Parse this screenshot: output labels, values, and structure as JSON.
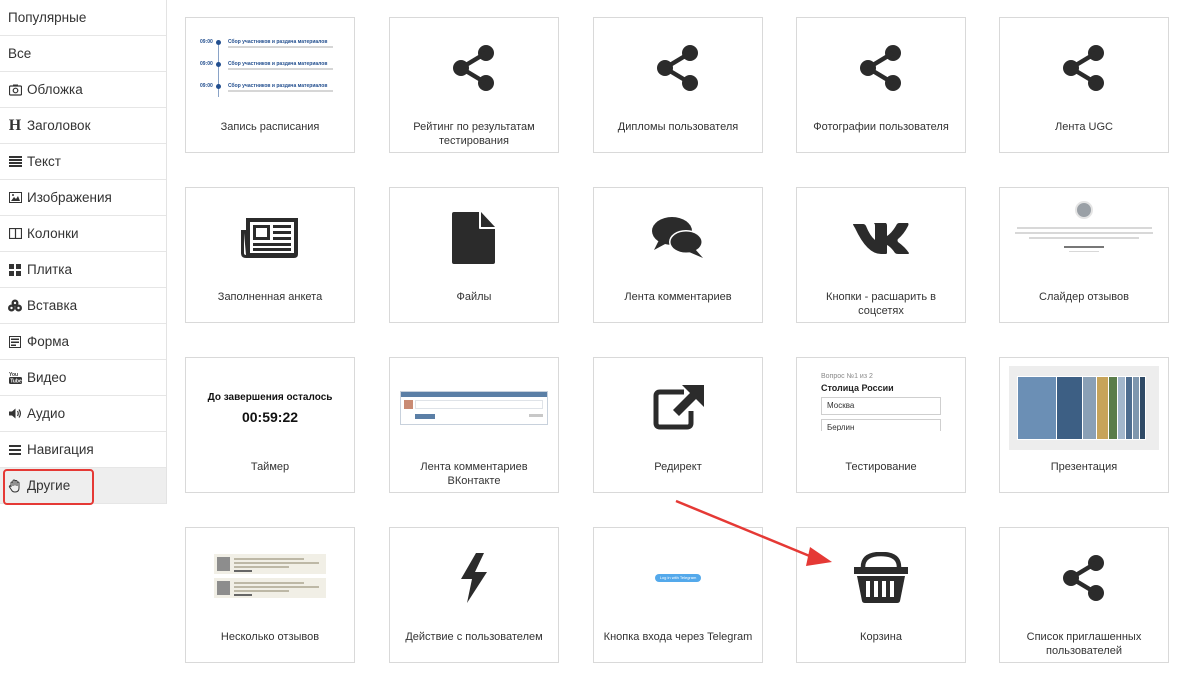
{
  "sidebar": {
    "items": [
      {
        "label": "Популярные",
        "icon": null
      },
      {
        "label": "Все",
        "icon": null
      },
      {
        "label": "Обложка",
        "icon": "camera-icon"
      },
      {
        "label": "Заголовок",
        "icon": "heading-icon"
      },
      {
        "label": "Текст",
        "icon": "text-lines-icon"
      },
      {
        "label": "Изображения",
        "icon": "image-icon"
      },
      {
        "label": "Колонки",
        "icon": "columns-icon"
      },
      {
        "label": "Плитка",
        "icon": "tiles-icon"
      },
      {
        "label": "Вставка",
        "icon": "puzzle-icon"
      },
      {
        "label": "Форма",
        "icon": "form-icon"
      },
      {
        "label": "Видео",
        "icon": "youtube-icon"
      },
      {
        "label": "Аудио",
        "icon": "speaker-icon"
      },
      {
        "label": "Навигация",
        "icon": "menu-icon"
      },
      {
        "label": "Другие",
        "icon": "hand-icon"
      }
    ],
    "heading_glyph": "H",
    "active_label": "Другие"
  },
  "colors": {
    "highlight": "#e53935",
    "arrow": "#e53935",
    "icon": "#2b2b2b",
    "telegram": "#54a9eb",
    "schedule_blue": "#234f8f"
  },
  "cards": [
    {
      "label": "Запись расписания",
      "icon": "schedule-preview"
    },
    {
      "label": "Рейтинг по результатам тестирования",
      "icon": "share-icon"
    },
    {
      "label": "Дипломы пользователя",
      "icon": "share-icon"
    },
    {
      "label": "Фотографии пользователя",
      "icon": "share-icon"
    },
    {
      "label": "Лента UGC",
      "icon": "share-icon"
    },
    {
      "label": "Заполненная анкета",
      "icon": "newspaper-icon"
    },
    {
      "label": "Файлы",
      "icon": "file-icon"
    },
    {
      "label": "Лента комментариев",
      "icon": "comments-icon"
    },
    {
      "label": "Кнопки - расшарить в соцсетях",
      "icon": "vk-icon"
    },
    {
      "label": "Слайдер отзывов",
      "icon": "review-slider-preview"
    },
    {
      "label": "Таймер",
      "icon": "timer-preview"
    },
    {
      "label": "Лента комментариев ВКонтакте",
      "icon": "vk-comments-preview"
    },
    {
      "label": "Редирект",
      "icon": "external-link-icon"
    },
    {
      "label": "Тестирование",
      "icon": "quiz-preview"
    },
    {
      "label": "Презентация",
      "icon": "presentation-preview"
    },
    {
      "label": "Несколько отзывов",
      "icon": "reviews-preview"
    },
    {
      "label": "Действие с пользователем",
      "icon": "bolt-icon"
    },
    {
      "label": "Кнопка входа через Telegram",
      "icon": "telegram-button-preview"
    },
    {
      "label": "Корзина",
      "icon": "basket-icon"
    },
    {
      "label": "Список приглашенных пользователей",
      "icon": "share-icon"
    }
  ],
  "schedule_preview": {
    "rows": [
      {
        "time": "09:00",
        "title": "Сбор участников и раздача материалов"
      },
      {
        "time": "09:00",
        "title": "Сбор участников и раздача материалов"
      },
      {
        "time": "09:00",
        "title": "Сбор участников и раздача материалов"
      }
    ]
  },
  "timer_preview": {
    "title": "До завершения осталось",
    "value": "00:59:22"
  },
  "quiz_preview": {
    "counter": "Вопрос №1 из 2",
    "question": "Столица России",
    "options": [
      "Москва",
      "Берлин"
    ]
  },
  "telegram_preview": {
    "button_text": "Log in with Telegram"
  }
}
